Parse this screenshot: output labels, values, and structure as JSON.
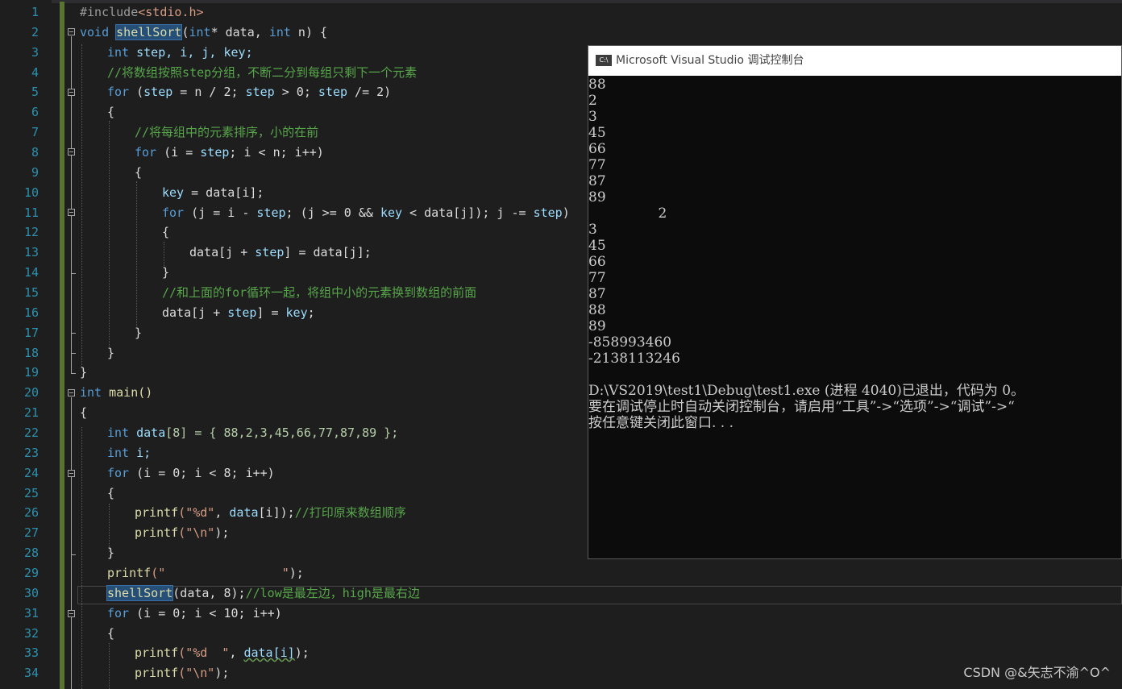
{
  "editor": {
    "line_numbers": [
      "1",
      "2",
      "3",
      "4",
      "5",
      "6",
      "7",
      "8",
      "9",
      "10",
      "11",
      "12",
      "13",
      "14",
      "15",
      "16",
      "17",
      "18",
      "19",
      "20",
      "21",
      "22",
      "23",
      "24",
      "25",
      "26",
      "27",
      "28",
      "29",
      "30",
      "31",
      "32",
      "33",
      "34"
    ],
    "code": {
      "l1_include": "#include",
      "l1_header": "<stdio.h>",
      "l2_void": "void",
      "l2_fn": "shellSort",
      "l2_open": "(",
      "l2_int": "int",
      "l2_rest_a": "* data, ",
      "l2_int2": "int",
      "l2_rest_b": " n) {",
      "l3_int": "int",
      "l3_vars": " step, i, j, key;",
      "l4_comment": "//将数组按照step分组，不断二分到每组只剩下一个元素",
      "l5_for": "for",
      "l5_rest_a": " (",
      "l5_step": "step",
      "l5_rest_b": " = n / 2; ",
      "l5_step2": "step",
      "l5_rest_c": " > 0; ",
      "l5_step3": "step",
      "l5_rest_d": " /= 2)",
      "l6": "{",
      "l7_comment": "//将每组中的元素排序，小的在前",
      "l8_for": "for",
      "l8_rest_a": " (i = ",
      "l8_step": "step",
      "l8_rest_b": "; i < n; i++)",
      "l9": "{",
      "l10_key": "key",
      "l10_rest": " = data[i];",
      "l11_for": "for",
      "l11_rest_a": " (j = i - ",
      "l11_step": "step",
      "l11_rest_b": "; (j >= 0 && ",
      "l11_key": "key",
      "l11_rest_c": " < data[j]); j -= ",
      "l11_step2": "step",
      "l11_rest_d": ")",
      "l12": "{",
      "l13_a": "data[j + ",
      "l13_step": "step",
      "l13_b": "] = data[j];",
      "l14": "}",
      "l15_comment": "//和上面的for循环一起，将组中小的元素换到数组的前面",
      "l16_a": "data[j + ",
      "l16_step": "step",
      "l16_b": "] = ",
      "l16_key": "key",
      "l16_c": ";",
      "l17": "}",
      "l18": "}",
      "l19": "}",
      "l20_int": "int",
      "l20_main": " main()",
      "l21": "{",
      "l22_int": "int",
      "l22_data": " data",
      "l22_rest": "[8] = { 88,2,3,45,66,77,87,89 };",
      "l23_int": "int",
      "l23_rest": " i;",
      "l24_for": "for",
      "l24_rest": " (i = 0; i < 8; i++)",
      "l25": "{",
      "l26_printf": "printf",
      "l26_str": "(\"%d\"",
      "l26_rest": ", ",
      "l26_data": "data",
      "l26_rest2": "[i]);",
      "l26_comment": "//打印原来数组顺序",
      "l27_printf": "printf",
      "l27_str": "(\"\\n\"",
      "l27_rest": ");",
      "l28": "}",
      "l29_printf": "printf",
      "l29_str": "(\"                \"",
      "l29_rest": ");",
      "l30_fn": "shellSort",
      "l30_rest": "(data, 8);",
      "l30_comment": "//low是最左边，high是最右边",
      "l31_for": "for",
      "l31_rest": " (i = 0; i < 10; i++)",
      "l32": "{",
      "l33_printf": "printf",
      "l33_str": "(\"%d  \"",
      "l33_rest": ", ",
      "l33_data": "data[i]",
      "l33_rest2": ");",
      "l34_printf": "printf",
      "l34_str": "(\"\\n\"",
      "l34_rest": ");"
    }
  },
  "console": {
    "title": "Microsoft Visual Studio 调试控制台",
    "icon_label": "C:\\",
    "lines": [
      "88",
      "2",
      "3",
      "45",
      "66",
      "77",
      "87",
      "89",
      "                2",
      "3",
      "45",
      "66",
      "77",
      "87",
      "88",
      "89",
      "-858993460",
      "-2138113246",
      "",
      "D:\\VS2019\\test1\\Debug\\test1.exe (进程 4040)已退出，代码为 0。",
      "要在调试停止时自动关闭控制台，请启用“工具”->“选项”->“调试”->“",
      "按任意键关闭此窗口. . ."
    ]
  },
  "watermark": "CSDN @&矢志不渝^O^",
  "colors": {
    "editor_bg": "#1e1e1e",
    "keyword": "#569cd6",
    "comment": "#57a64a",
    "line_number": "#2b91af",
    "console_bg": "#0c0c0c"
  }
}
